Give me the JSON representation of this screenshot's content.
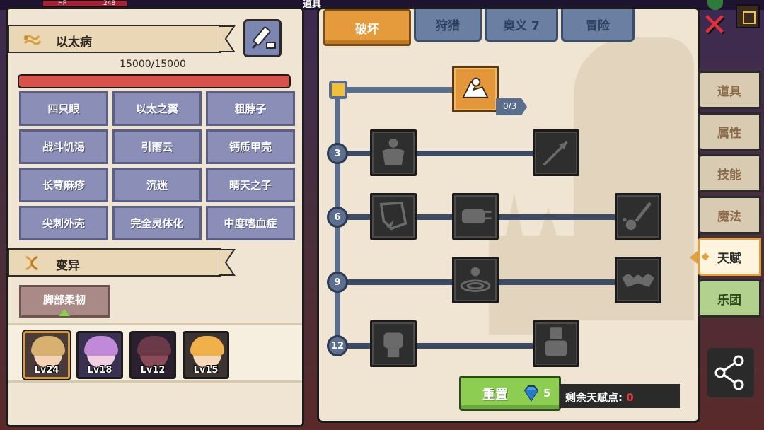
{
  "hud": {
    "hp_label": "HP",
    "hp_value": "248",
    "top_item": "道具",
    "close_icon": "close-x-icon",
    "corner_icon": "fullscreen-icon"
  },
  "left": {
    "disease_title": "以太病",
    "hp_text": "15000/15000",
    "hp_fraction": 1.0,
    "traits": [
      "四只眼",
      "以太之翼",
      "粗脖子",
      "战斗饥渴",
      "引雨云",
      "钙质甲壳",
      "长荨麻疹",
      "沉迷",
      "晴天之子",
      "尖刺外壳",
      "完全灵体化",
      "中度嗜血症"
    ],
    "mutation_title": "变异",
    "mutation_item": "脚部柔韧",
    "heroes": [
      {
        "level": "Lv24",
        "selected": true,
        "hair": "#d8b070",
        "skin": "#f3d3b3",
        "bg": "#4a3a3a"
      },
      {
        "level": "Lv18",
        "selected": false,
        "hair": "#c08ad8",
        "skin": "#f0d0e0",
        "bg": "#3a3050"
      },
      {
        "level": "Lv12",
        "selected": false,
        "hair": "#6a3a4a",
        "skin": "#8a4a5a",
        "bg": "#2a2030"
      },
      {
        "level": "Lv15",
        "selected": false,
        "hair": "#f0b04a",
        "skin": "#f5d8b8",
        "bg": "#3a3330"
      }
    ]
  },
  "tabs": [
    {
      "label": "破坏",
      "active": true
    },
    {
      "label": "狩猎",
      "active": false
    },
    {
      "label": "奥义 7",
      "active": false
    },
    {
      "label": "冒险",
      "active": false
    }
  ],
  "talent": {
    "levels": [
      "3",
      "6",
      "9",
      "12"
    ],
    "top_skill_count": "0/3",
    "skills": [
      {
        "name": "arm-wrestle-icon",
        "active": true
      },
      {
        "name": "giant-body-icon",
        "active": false
      },
      {
        "name": "arrow-icon",
        "active": false
      },
      {
        "name": "shatter-icon",
        "active": false
      },
      {
        "name": "fist-punch-icon",
        "active": false
      },
      {
        "name": "splash-strike-icon",
        "active": false
      },
      {
        "name": "ground-ripple-icon",
        "active": false
      },
      {
        "name": "bat-wing-icon",
        "active": false
      },
      {
        "name": "raised-fist-icon",
        "active": false
      },
      {
        "name": "gauntlet-fist-icon",
        "active": false
      }
    ],
    "reset_label": "重置",
    "reset_cost": "5",
    "points_label": "剩余天赋点:",
    "points_value": "0"
  },
  "side_tabs": [
    {
      "label": "道具",
      "active": false
    },
    {
      "label": "属性",
      "active": false
    },
    {
      "label": "技能",
      "active": false
    },
    {
      "label": "魔法",
      "active": false
    },
    {
      "label": "天赋",
      "active": true
    },
    {
      "label": "乐团",
      "active": false
    }
  ],
  "colors": {
    "panel_bg": "#efe5d2",
    "active_tab": "#e59a3c",
    "trait_bg": "#8b8fb7",
    "hp_fill": "#d7524a",
    "reset_green": "#8ccd52",
    "points_red": "#e23a3a"
  }
}
